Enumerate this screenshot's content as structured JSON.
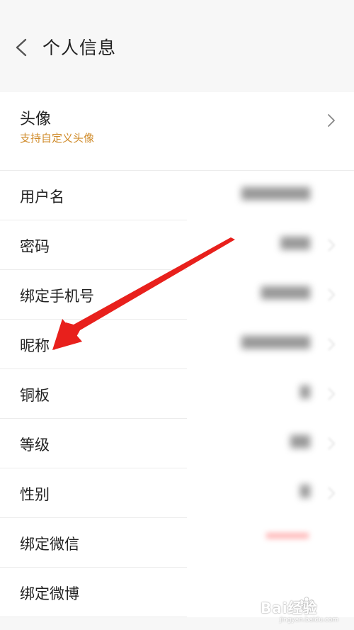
{
  "header": {
    "title": "个人信息",
    "back_icon": "chevron-left-icon"
  },
  "avatar": {
    "label": "头像",
    "subtitle": "支持自定义头像",
    "chevron_icon": "chevron-right-icon",
    "subtitle_color": "#d08c2c"
  },
  "rows": [
    {
      "label": "用户名"
    },
    {
      "label": "密码"
    },
    {
      "label": "绑定手机号"
    },
    {
      "label": "昵称"
    },
    {
      "label": "铜板"
    },
    {
      "label": "等级"
    },
    {
      "label": "性别"
    },
    {
      "label": "绑定微信"
    },
    {
      "label": "绑定微博"
    }
  ],
  "annotation": {
    "arrow_color": "#e8201c",
    "arrow_target": "昵称"
  },
  "watermark": {
    "text": "Bai经验",
    "subtext": "jingyan.baidu.com"
  }
}
